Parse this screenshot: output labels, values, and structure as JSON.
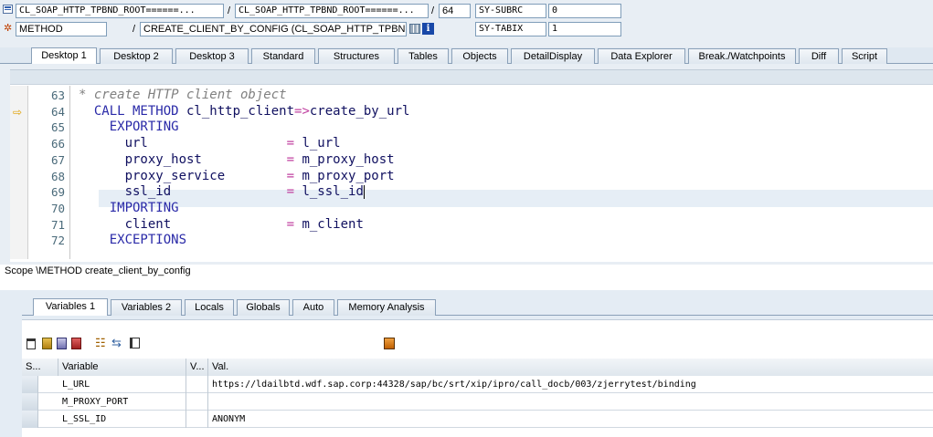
{
  "header": {
    "row1": {
      "field1": "CL_SOAP_HTTP_TPBND_ROOT======...",
      "sep1": "/",
      "field2": "CL_SOAP_HTTP_TPBND_ROOT======...",
      "sep2": "/",
      "line": "64",
      "sysvar_name": "SY-SUBRC",
      "sysvar_value": "0"
    },
    "row2": {
      "type": "METHOD",
      "sep": "/",
      "method": "CREATE_CLIENT_BY_CONFIG (CL_SOAP_HTTP_TPBND...",
      "sysvar_name": "SY-TABIX",
      "sysvar_value": "1"
    }
  },
  "tabs": [
    {
      "label": "Desktop 1",
      "active": true
    },
    {
      "label": "Desktop 2",
      "active": false
    },
    {
      "label": "Desktop 3",
      "active": false
    },
    {
      "label": "Standard",
      "active": false
    },
    {
      "label": "Structures",
      "active": false
    },
    {
      "label": "Tables",
      "active": false
    },
    {
      "label": "Objects",
      "active": false
    },
    {
      "label": "DetailDisplay",
      "active": false
    },
    {
      "label": "Data Explorer",
      "active": false
    },
    {
      "label": "Break./Watchpoints",
      "active": false
    },
    {
      "label": "Diff",
      "active": false
    },
    {
      "label": "Script",
      "active": false
    }
  ],
  "code": {
    "lines": [
      {
        "no": "63",
        "text": "* create HTTP client object",
        "kind": "comment"
      },
      {
        "no": "64",
        "text": "  CALL METHOD cl_http_client=>create_by_url",
        "kind": "code",
        "current": true
      },
      {
        "no": "65",
        "text": "    EXPORTING",
        "kind": "keyword"
      },
      {
        "no": "66",
        "text": "      url                  = l_url",
        "kind": "code"
      },
      {
        "no": "67",
        "text": "      proxy_host           = m_proxy_host",
        "kind": "code"
      },
      {
        "no": "68",
        "text": "      proxy_service        = m_proxy_port",
        "kind": "code"
      },
      {
        "no": "69",
        "text": "      ssl_id               = l_ssl_id",
        "kind": "code",
        "cursor": true
      },
      {
        "no": "70",
        "text": "    IMPORTING",
        "kind": "keyword"
      },
      {
        "no": "71",
        "text": "      client               = m_client",
        "kind": "code"
      },
      {
        "no": "72",
        "text": "    EXCEPTIONS",
        "kind": "keyword"
      }
    ]
  },
  "scope": "Scope \\METHOD create_client_by_config",
  "var_tabs": [
    {
      "label": "Variables 1",
      "active": true
    },
    {
      "label": "Variables 2",
      "active": false
    },
    {
      "label": "Locals",
      "active": false
    },
    {
      "label": "Globals",
      "active": false
    },
    {
      "label": "Auto",
      "active": false
    },
    {
      "label": "Memory Analysis",
      "active": false
    }
  ],
  "toolbar_icons": [
    "delete-icon",
    "insert-icon",
    "append-icon",
    "save-icon",
    "tree-icon",
    "transfer-icon",
    "clear-icon"
  ],
  "grid": {
    "headers": {
      "s": "S...",
      "variable": "Variable",
      "v": "V...",
      "val": "Val."
    },
    "rows": [
      {
        "variable": "L_URL",
        "value": "https://ldailbtd.wdf.sap.corp:44328/sap/bc/srt/xip/ipro/call_docb/003/zjerrytest/binding"
      },
      {
        "variable": "M_PROXY_PORT",
        "value": ""
      },
      {
        "variable": "L_SSL_ID",
        "value": "ANONYM"
      }
    ]
  },
  "colors": {
    "accent": "#2a2aa8",
    "comment": "#808080",
    "panel": "#e4ecf4"
  }
}
